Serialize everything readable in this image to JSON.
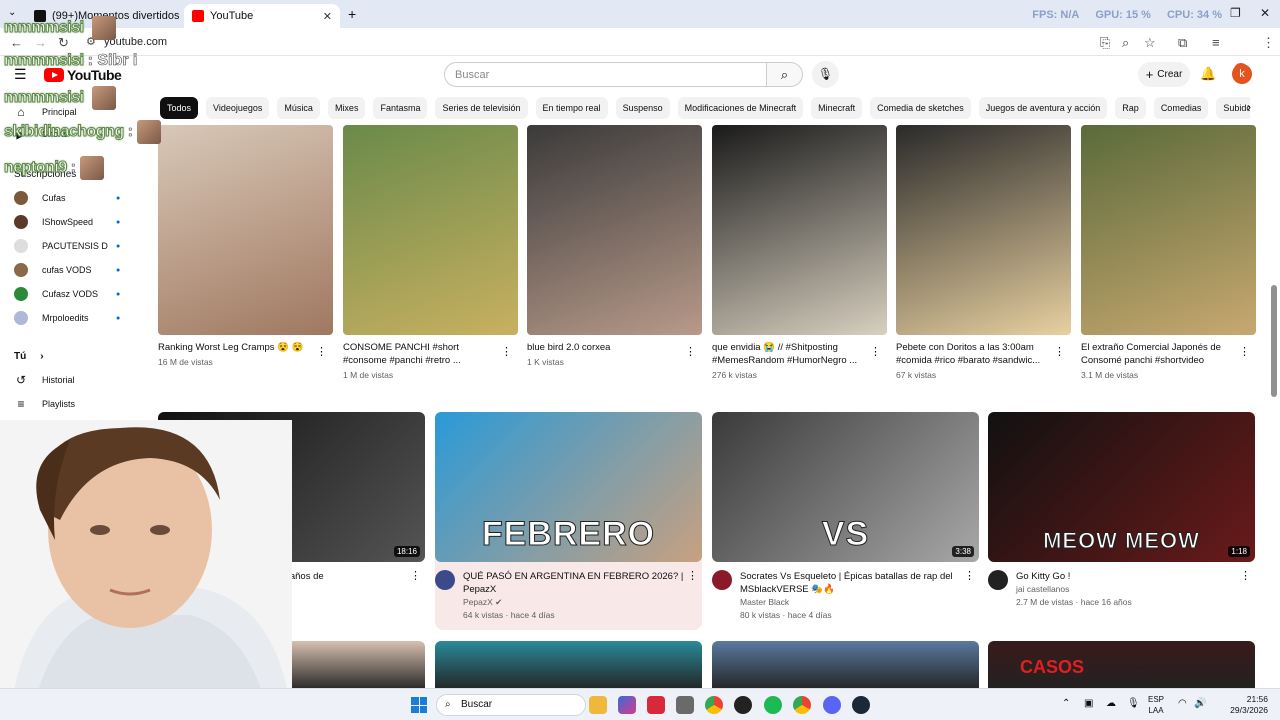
{
  "browser": {
    "tabs": [
      {
        "title": "(99+)Momentos divertidos pa...",
        "favicon_color": "#111111"
      },
      {
        "title": "YouTube",
        "favicon_color": "#ff0000"
      }
    ],
    "new_tab": "+",
    "url": "youtube.com",
    "hud": {
      "fps": "FPS: N/A",
      "gpu": "GPU: 15 %",
      "cpu": "CPU: 34 %"
    }
  },
  "header": {
    "logo": "YouTube",
    "search_placeholder": "Buscar",
    "create_label": "Crear",
    "avatar_letter": "k"
  },
  "chips": [
    "Todos",
    "Videojuegos",
    "Música",
    "Mixes",
    "Fantasma",
    "Series de televisión",
    "En tiempo real",
    "Suspenso",
    "Modificaciones de Minecraft",
    "Minecraft",
    "Comedia de sketches",
    "Juegos de aventura y acción",
    "Rap",
    "Comedias",
    "Subidos recientemente"
  ],
  "sidebar": {
    "home": "Principal",
    "shorts": "Shorts",
    "subs_heading": "Suscripciones",
    "subs": [
      {
        "name": "Cufas",
        "color": "#7a5a3a"
      },
      {
        "name": "IShowSpeed",
        "color": "#5a3a2a"
      },
      {
        "name": "PACUTENSIS D",
        "color": "#dddddd"
      },
      {
        "name": "cufas VODS",
        "color": "#8a6a4a"
      },
      {
        "name": "Cufasz VODS",
        "color": "#2a8a3a"
      },
      {
        "name": "Mrpoloedits",
        "color": "#b0b8d8"
      }
    ],
    "you_heading": "Tú",
    "you_items": [
      "Historial",
      "Playlists"
    ]
  },
  "shorts": [
    {
      "title": "Ranking Worst Leg Cramps 😵 😵",
      "meta": "16 M de vistas",
      "colors": [
        "#d8c8b8",
        "#a07860"
      ]
    },
    {
      "title": "CONSOME PANCHI #short #consome #panchi #retro ...",
      "meta": "1 M de vistas",
      "colors": [
        "#6a8a4a",
        "#c8b060"
      ]
    },
    {
      "title": "blue bird 2.0 corxea",
      "meta": "1 K vistas",
      "colors": [
        "#3a3a3a",
        "#b89a8a"
      ]
    },
    {
      "title": "que envidia 😭 // #Shitposting #MemesRandom #HumorNegro ...",
      "meta": "276 k vistas",
      "colors": [
        "#1a1a1a",
        "#d8d0c0"
      ]
    },
    {
      "title": "Pebete con Doritos a las 3:00am #comida #rico #barato #sandwic...",
      "meta": "67 k vistas",
      "colors": [
        "#2a2a2a",
        "#e8d0a0"
      ]
    },
    {
      "title": "El extraño Comercial Japonés de Consomé panchi #shortvideo",
      "meta": "3.1 M de vistas",
      "colors": [
        "#5a6a3a",
        "#c8a870"
      ]
    }
  ],
  "videos": [
    {
      "title": "...n de Estos Videos Extraños de",
      "channel": "",
      "stats": "...es",
      "duration": "18:16",
      "colors": [
        "#111111",
        "#555555"
      ],
      "avatar": "#333333"
    },
    {
      "title": "QUÉ PASÓ EN ARGENTINA EN FEBRERO 2026? | PepazX",
      "channel": "PepazX ✔",
      "stats": "64 k vistas · hace 4 días",
      "duration": "",
      "overlay": "FEBRERO",
      "colors": [
        "#2a9ad8",
        "#c8a080"
      ],
      "avatar": "#3a4a8a"
    },
    {
      "title": "Socrates Vs Esqueleto | Épicas batallas de rap del MSblackVERSE 🎭🔥",
      "channel": "Master Black",
      "stats": "80 k vistas · hace 4 días",
      "duration": "3:38",
      "overlay": "VS",
      "colors": [
        "#3a3a3a",
        "#a8a8a8"
      ],
      "avatar": "#8a1a2a"
    },
    {
      "title": "Go Kitty Go !",
      "channel": "jai castellanos",
      "stats": "2.7 M de vistas · hace 16 años",
      "duration": "1:18",
      "overlay": "MEOW MEOW",
      "colors": [
        "#111111",
        "#6a1a1a"
      ],
      "avatar": "#222222"
    }
  ],
  "row3_colors": [
    "#d8c0b0",
    "#2a8a9a",
    "#5a7aa0",
    "#3a1a1a"
  ],
  "row3_text": "CASOS",
  "overlay_chat": [
    {
      "name": "mmmmsisi",
      "msg": ""
    },
    {
      "name": "mmmmsisi",
      "msg": ": Sibr i"
    },
    {
      "name": "mmmmsisi",
      "msg": ""
    },
    {
      "name": "skibidinachogng",
      "msg": ":"
    },
    {
      "name": "neptoni9",
      "msg": ":"
    }
  ],
  "taskbar": {
    "search": "Buscar",
    "lang": [
      "ESP",
      "LAA"
    ],
    "time": "21:56",
    "date": "29/3/2026"
  }
}
